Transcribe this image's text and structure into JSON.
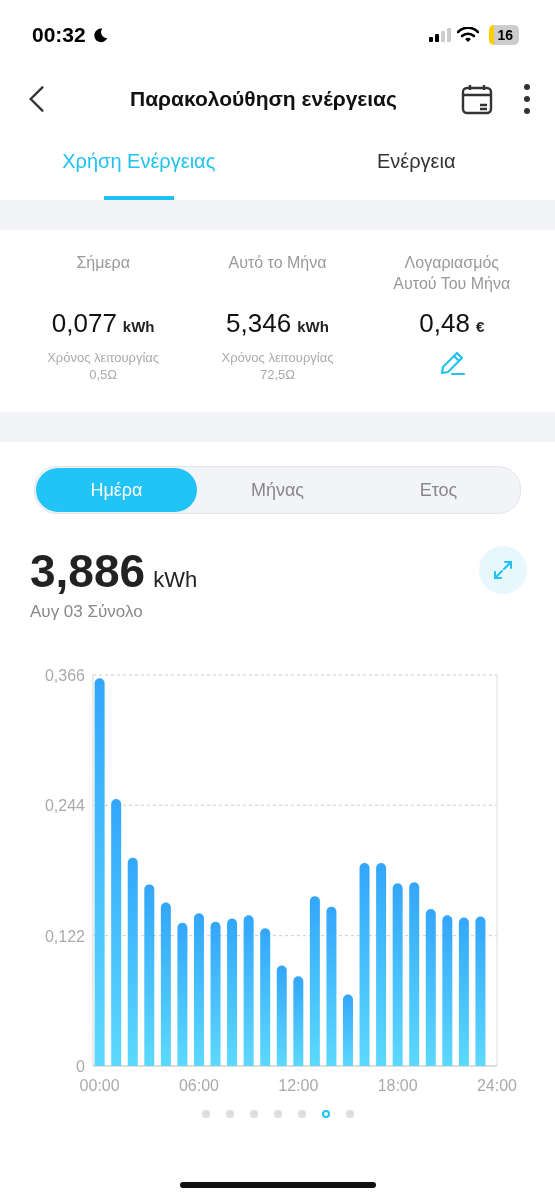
{
  "status_bar": {
    "time": "00:32",
    "battery": "16"
  },
  "header": {
    "title": "Παρακολούθηση ενέργειας"
  },
  "tabs": [
    {
      "label": "Χρήση Ενέργειας",
      "selected": true
    },
    {
      "label": "Ενέργεια",
      "selected": false
    }
  ],
  "stats": [
    {
      "label": "Σήμερα",
      "value": "0,077",
      "unit": "kWh",
      "note": "Χρόνος λειτουργίας",
      "note_value": "0,5Ω",
      "kind": "usage"
    },
    {
      "label": "Αυτό το Μήνα",
      "value": "5,346",
      "unit": "kWh",
      "note": "Χρόνος λειτουργίας",
      "note_value": "72,5Ω",
      "kind": "usage"
    },
    {
      "label": "Λογαριασμός Αυτού Του Μήνα",
      "value": "0,48",
      "unit": "€",
      "kind": "bill"
    }
  ],
  "periods": [
    {
      "label": "Ημέρα",
      "selected": true
    },
    {
      "label": "Μήνας",
      "selected": false
    },
    {
      "label": "Ετος",
      "selected": false
    }
  ],
  "summary": {
    "value": "3,886",
    "unit": "kWh",
    "caption": "Αυγ 03 Σύνολο"
  },
  "chart_data": {
    "type": "bar",
    "x": [
      0,
      1,
      2,
      3,
      4,
      5,
      6,
      7,
      8,
      9,
      10,
      11,
      12,
      13,
      14,
      15,
      16,
      17,
      18,
      19,
      20,
      21,
      22,
      23
    ],
    "values": [
      0.363,
      0.25,
      0.195,
      0.17,
      0.153,
      0.134,
      0.143,
      0.135,
      0.138,
      0.141,
      0.129,
      0.094,
      0.084,
      0.159,
      0.149,
      0.067,
      0.19,
      0.19,
      0.171,
      0.172,
      0.147,
      0.141,
      0.139,
      0.14
    ],
    "xlim": [
      -0.4,
      24
    ],
    "ylim": [
      0,
      0.366
    ],
    "yticks": [
      {
        "value": 0,
        "label": "0"
      },
      {
        "value": 0.122,
        "label": "0,122"
      },
      {
        "value": 0.244,
        "label": "0,244"
      },
      {
        "value": 0.366,
        "label": "0,366"
      }
    ],
    "xticks": [
      {
        "value": 0,
        "label": "00:00"
      },
      {
        "value": 6,
        "label": "06:00"
      },
      {
        "value": 12,
        "label": "12:00"
      },
      {
        "value": 18,
        "label": "18:00"
      },
      {
        "value": 24,
        "label": "24:00"
      }
    ]
  },
  "pages": [
    {
      "selected": false
    },
    {
      "selected": false
    },
    {
      "selected": false
    },
    {
      "selected": false
    },
    {
      "selected": false
    },
    {
      "selected": true
    },
    {
      "selected": false
    }
  ]
}
